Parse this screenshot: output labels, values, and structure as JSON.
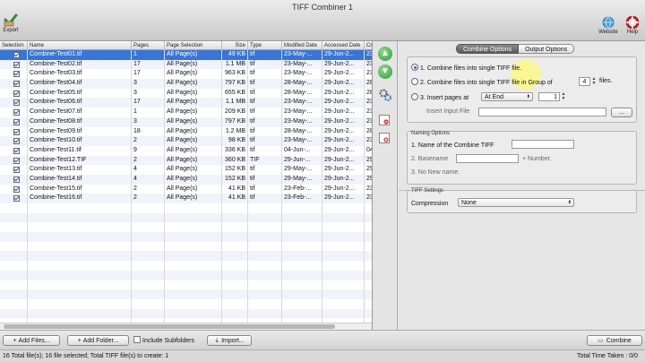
{
  "window": {
    "title": "TIFF Combiner 1"
  },
  "toolbar": {
    "export_label": "Export",
    "website_label": "Website",
    "help_label": "Help"
  },
  "table": {
    "columns": [
      "Selection",
      "Name",
      "Pages",
      "Page Selection",
      "Size",
      "Type",
      "Modified Date",
      "Accessed Date",
      "Cr"
    ],
    "rows": [
      {
        "name": "Combine-Test01.tif",
        "pages": "1",
        "page_selection": "All Page(s)",
        "size": "49 KB",
        "type": "tif",
        "modified": "23-May-...",
        "accessed": "29-Jun-2...",
        "cr": "23"
      },
      {
        "name": "Combine-Test02.tif",
        "pages": "17",
        "page_selection": "All Page(s)",
        "size": "1.1 MB",
        "type": "tif",
        "modified": "23-May-...",
        "accessed": "29-Jun-2...",
        "cr": "23"
      },
      {
        "name": "Combine-Test03.tif",
        "pages": "17",
        "page_selection": "All Page(s)",
        "size": "963 KB",
        "type": "tif",
        "modified": "23-May-...",
        "accessed": "29-Jun-2...",
        "cr": "23"
      },
      {
        "name": "Combine-Test04.tif",
        "pages": "3",
        "page_selection": "All Page(s)",
        "size": "797 KB",
        "type": "tif",
        "modified": "28-May-...",
        "accessed": "29-Jun-2...",
        "cr": "28"
      },
      {
        "name": "Combine-Test05.tif",
        "pages": "3",
        "page_selection": "All Page(s)",
        "size": "655 KB",
        "type": "tif",
        "modified": "28-May-...",
        "accessed": "29-Jun-2...",
        "cr": "28"
      },
      {
        "name": "Combine-Test06.tif",
        "pages": "17",
        "page_selection": "All Page(s)",
        "size": "1.1 MB",
        "type": "tif",
        "modified": "23-May-...",
        "accessed": "29-Jun-2...",
        "cr": "23"
      },
      {
        "name": "Combine-Test07.tif",
        "pages": "1",
        "page_selection": "All Page(s)",
        "size": "209 KB",
        "type": "tif",
        "modified": "23-May-...",
        "accessed": "29-Jun-2...",
        "cr": "23"
      },
      {
        "name": "Combine-Test08.tif",
        "pages": "3",
        "page_selection": "All Page(s)",
        "size": "797 KB",
        "type": "tif",
        "modified": "23-May-...",
        "accessed": "29-Jun-2...",
        "cr": "23"
      },
      {
        "name": "Combine-Test09.tif",
        "pages": "18",
        "page_selection": "All Page(s)",
        "size": "1.2 MB",
        "type": "tif",
        "modified": "28-May-...",
        "accessed": "29-Jun-2...",
        "cr": "28"
      },
      {
        "name": "Combine-Test10.tif",
        "pages": "2",
        "page_selection": "All Page(s)",
        "size": "98 KB",
        "type": "tif",
        "modified": "23-May-...",
        "accessed": "29-Jun-2...",
        "cr": "23"
      },
      {
        "name": "Combine-Test11.tif",
        "pages": "9",
        "page_selection": "All Page(s)",
        "size": "336 KB",
        "type": "tif",
        "modified": "04-Jun-...",
        "accessed": "29-Jun-2...",
        "cr": "04"
      },
      {
        "name": "Combine-Test12.TIF",
        "pages": "2",
        "page_selection": "All Page(s)",
        "size": "360 KB",
        "type": "TIF",
        "modified": "29-Jun-...",
        "accessed": "29-Jun-2...",
        "cr": "29"
      },
      {
        "name": "Combine-Test13.tif",
        "pages": "4",
        "page_selection": "All Page(s)",
        "size": "152 KB",
        "type": "tif",
        "modified": "29-May-...",
        "accessed": "29-Jun-2...",
        "cr": "29"
      },
      {
        "name": "Combine-Test14.tif",
        "pages": "4",
        "page_selection": "All Page(s)",
        "size": "152 KB",
        "type": "tif",
        "modified": "29-May-...",
        "accessed": "29-Jun-2...",
        "cr": "29"
      },
      {
        "name": "Combine-Test15.tif",
        "pages": "2",
        "page_selection": "All Page(s)",
        "size": "41 KB",
        "type": "tif",
        "modified": "23-Feb-...",
        "accessed": "29-Jun-2...",
        "cr": "23"
      },
      {
        "name": "Combine-Test16.tif",
        "pages": "2",
        "page_selection": "All Page(s)",
        "size": "41 KB",
        "type": "tif",
        "modified": "23-Feb-...",
        "accessed": "29-Jun-2...",
        "cr": "23"
      }
    ]
  },
  "options": {
    "tabs": [
      "Combine Options",
      "Output Options"
    ],
    "combine_single": "1. Combine files into single TIFF file.",
    "combine_group_prefix": "2. Combine files into single TIFF file in Group of",
    "group_value": "4",
    "combine_group_suffix": "files.",
    "insert_pages": "3. Insert pages at",
    "insert_position": "At End",
    "insert_page_value": "1",
    "insert_input_label": "Insert Input File",
    "browse_label": "...",
    "naming_title": "Naming Options",
    "naming_name": "1. Name of the Combine TIFF",
    "naming_basename": "2. Basename",
    "naming_number": "+ Number.",
    "naming_no_new": "3. No New name.",
    "tiff_title": "TIFF Settings",
    "compression_label": "Compression",
    "compression_value": "None"
  },
  "bottom": {
    "add_files": "Add Files...",
    "add_folder": "Add Folder...",
    "include_subfolders": "Include Subfolders",
    "import": "Import...",
    "combine": "Combine"
  },
  "status": {
    "left": "16 Total file(s); 16 file selected; Total TIFF file(s) to create: 1",
    "right": "Total Time Taken : 0/0"
  }
}
